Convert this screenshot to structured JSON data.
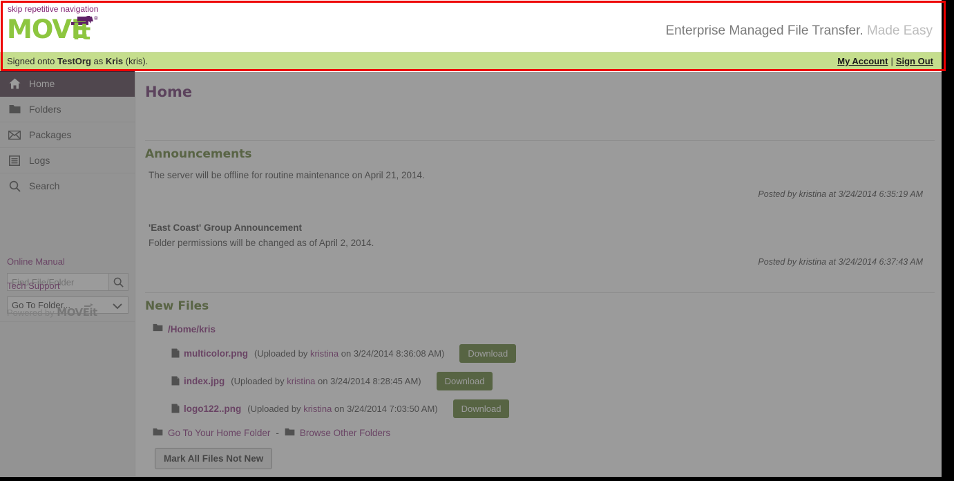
{
  "header": {
    "skip_link": "skip repetitive navigation",
    "logo_move": "MOVE",
    "logo_it": "it",
    "logo_reg": "®",
    "tagline_primary": "Enterprise Managed File Transfer.",
    "tagline_secondary": "Made Easy",
    "accent_green": "#8dc63f",
    "accent_purple": "#5f2167"
  },
  "signed_bar": {
    "prefix": "Signed onto ",
    "org": "TestOrg",
    "middle": " as ",
    "user_display": "Kris",
    "suffix": " (kris).",
    "my_account": "My Account",
    "separator": "|",
    "sign_out": "Sign Out",
    "bar_color": "#c5de8d"
  },
  "sidebar": {
    "items": [
      {
        "label": "Home",
        "icon": "home-icon",
        "active": true
      },
      {
        "label": "Folders",
        "icon": "folder-icon",
        "active": false
      },
      {
        "label": "Packages",
        "icon": "envelope-icon",
        "active": false
      },
      {
        "label": "Logs",
        "icon": "logs-icon",
        "active": false
      }
    ],
    "search_label": "Search",
    "search_icon": "search-icon",
    "search_placeholder": "Find File/Folder",
    "search_value": "",
    "goto_folder_label": "Go To Folder...",
    "goto_folder_options": [
      "Go To Folder..."
    ],
    "online_manual": "Online Manual",
    "tech_support": "Tech Support",
    "powered_by_prefix": "Powered by ",
    "powered_by_logo": "MOVEit",
    "active_color": "#3b2236"
  },
  "main": {
    "page_title": "Home",
    "announcements": {
      "section_title": "Announcements",
      "items": [
        {
          "title": "",
          "text": "The server will be offline for routine maintenance on April 21, 2014.",
          "posted": "Posted by kristina at 3/24/2014 6:35:19 AM"
        },
        {
          "title": "'East Coast' Group Announcement",
          "text": "Folder permissions will be changed as of April 2, 2014.",
          "posted": "Posted by kristina at 3/24/2014 6:37:43 AM"
        }
      ]
    },
    "new_files": {
      "section_title": "New Files",
      "folder_path": "/Home/kris",
      "files": [
        {
          "name": "multicolor.png",
          "meta_prefix": "(Uploaded by ",
          "uploader": "kristina",
          "meta_suffix": " on 3/24/2014 8:36:08 AM)",
          "download_label": "Download"
        },
        {
          "name": "index.jpg",
          "meta_prefix": "(Uploaded by ",
          "uploader": "kristina",
          "meta_suffix": " on 3/24/2014 8:28:45 AM)",
          "download_label": "Download"
        },
        {
          "name": "logo122..png",
          "meta_prefix": "(Uploaded by ",
          "uploader": "kristina",
          "meta_suffix": " on 3/24/2014 7:03:50 AM)",
          "download_label": "Download"
        }
      ],
      "home_folder_link": "Go To Your Home Folder",
      "link_dash": "-",
      "browse_folders_link": "Browse Other Folders",
      "mark_not_new_label": "Mark All Files Not New",
      "download_button_color": "#4d7018"
    },
    "section_title_color": "#52701f",
    "page_title_color": "#5b1a5e"
  },
  "highlight": {
    "color": "#ee0000"
  }
}
